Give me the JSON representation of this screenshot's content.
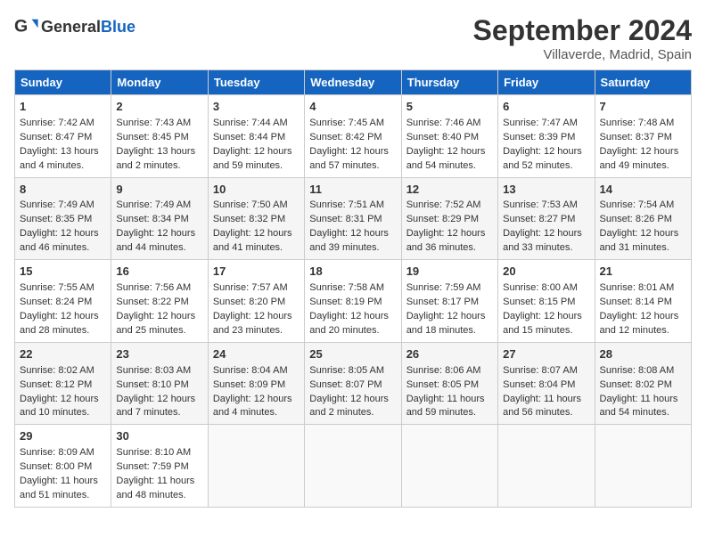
{
  "header": {
    "logo_general": "General",
    "logo_blue": "Blue",
    "month_title": "September 2024",
    "location": "Villaverde, Madrid, Spain"
  },
  "days_of_week": [
    "Sunday",
    "Monday",
    "Tuesday",
    "Wednesday",
    "Thursday",
    "Friday",
    "Saturday"
  ],
  "weeks": [
    [
      {
        "day": 1,
        "sunrise": "7:42 AM",
        "sunset": "8:47 PM",
        "daylight": "13 hours and 4 minutes."
      },
      {
        "day": 2,
        "sunrise": "7:43 AM",
        "sunset": "8:45 PM",
        "daylight": "13 hours and 2 minutes."
      },
      {
        "day": 3,
        "sunrise": "7:44 AM",
        "sunset": "8:44 PM",
        "daylight": "12 hours and 59 minutes."
      },
      {
        "day": 4,
        "sunrise": "7:45 AM",
        "sunset": "8:42 PM",
        "daylight": "12 hours and 57 minutes."
      },
      {
        "day": 5,
        "sunrise": "7:46 AM",
        "sunset": "8:40 PM",
        "daylight": "12 hours and 54 minutes."
      },
      {
        "day": 6,
        "sunrise": "7:47 AM",
        "sunset": "8:39 PM",
        "daylight": "12 hours and 52 minutes."
      },
      {
        "day": 7,
        "sunrise": "7:48 AM",
        "sunset": "8:37 PM",
        "daylight": "12 hours and 49 minutes."
      }
    ],
    [
      {
        "day": 8,
        "sunrise": "7:49 AM",
        "sunset": "8:35 PM",
        "daylight": "12 hours and 46 minutes."
      },
      {
        "day": 9,
        "sunrise": "7:49 AM",
        "sunset": "8:34 PM",
        "daylight": "12 hours and 44 minutes."
      },
      {
        "day": 10,
        "sunrise": "7:50 AM",
        "sunset": "8:32 PM",
        "daylight": "12 hours and 41 minutes."
      },
      {
        "day": 11,
        "sunrise": "7:51 AM",
        "sunset": "8:31 PM",
        "daylight": "12 hours and 39 minutes."
      },
      {
        "day": 12,
        "sunrise": "7:52 AM",
        "sunset": "8:29 PM",
        "daylight": "12 hours and 36 minutes."
      },
      {
        "day": 13,
        "sunrise": "7:53 AM",
        "sunset": "8:27 PM",
        "daylight": "12 hours and 33 minutes."
      },
      {
        "day": 14,
        "sunrise": "7:54 AM",
        "sunset": "8:26 PM",
        "daylight": "12 hours and 31 minutes."
      }
    ],
    [
      {
        "day": 15,
        "sunrise": "7:55 AM",
        "sunset": "8:24 PM",
        "daylight": "12 hours and 28 minutes."
      },
      {
        "day": 16,
        "sunrise": "7:56 AM",
        "sunset": "8:22 PM",
        "daylight": "12 hours and 25 minutes."
      },
      {
        "day": 17,
        "sunrise": "7:57 AM",
        "sunset": "8:20 PM",
        "daylight": "12 hours and 23 minutes."
      },
      {
        "day": 18,
        "sunrise": "7:58 AM",
        "sunset": "8:19 PM",
        "daylight": "12 hours and 20 minutes."
      },
      {
        "day": 19,
        "sunrise": "7:59 AM",
        "sunset": "8:17 PM",
        "daylight": "12 hours and 18 minutes."
      },
      {
        "day": 20,
        "sunrise": "8:00 AM",
        "sunset": "8:15 PM",
        "daylight": "12 hours and 15 minutes."
      },
      {
        "day": 21,
        "sunrise": "8:01 AM",
        "sunset": "8:14 PM",
        "daylight": "12 hours and 12 minutes."
      }
    ],
    [
      {
        "day": 22,
        "sunrise": "8:02 AM",
        "sunset": "8:12 PM",
        "daylight": "12 hours and 10 minutes."
      },
      {
        "day": 23,
        "sunrise": "8:03 AM",
        "sunset": "8:10 PM",
        "daylight": "12 hours and 7 minutes."
      },
      {
        "day": 24,
        "sunrise": "8:04 AM",
        "sunset": "8:09 PM",
        "daylight": "12 hours and 4 minutes."
      },
      {
        "day": 25,
        "sunrise": "8:05 AM",
        "sunset": "8:07 PM",
        "daylight": "12 hours and 2 minutes."
      },
      {
        "day": 26,
        "sunrise": "8:06 AM",
        "sunset": "8:05 PM",
        "daylight": "11 hours and 59 minutes."
      },
      {
        "day": 27,
        "sunrise": "8:07 AM",
        "sunset": "8:04 PM",
        "daylight": "11 hours and 56 minutes."
      },
      {
        "day": 28,
        "sunrise": "8:08 AM",
        "sunset": "8:02 PM",
        "daylight": "11 hours and 54 minutes."
      }
    ],
    [
      {
        "day": 29,
        "sunrise": "8:09 AM",
        "sunset": "8:00 PM",
        "daylight": "11 hours and 51 minutes."
      },
      {
        "day": 30,
        "sunrise": "8:10 AM",
        "sunset": "7:59 PM",
        "daylight": "11 hours and 48 minutes."
      },
      null,
      null,
      null,
      null,
      null
    ]
  ]
}
